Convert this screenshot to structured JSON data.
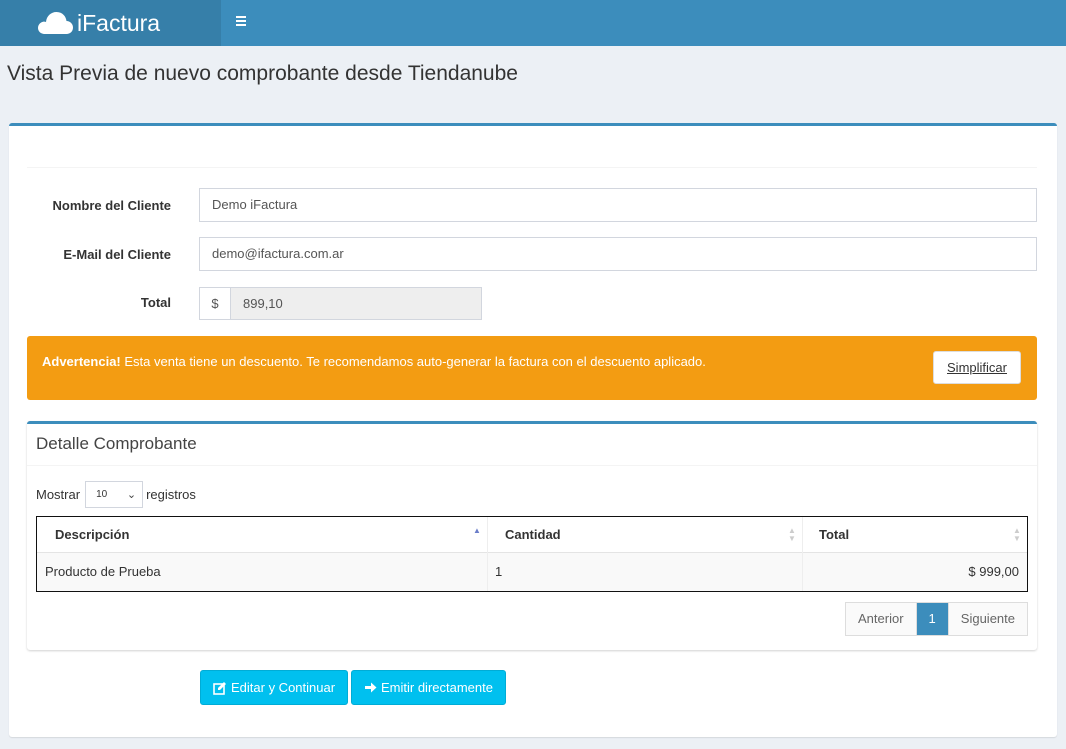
{
  "app": {
    "name": "iFactura"
  },
  "page": {
    "title": "Vista Previa de nuevo comprobante desde Tiendanube"
  },
  "form": {
    "client_name_label": "Nombre del Cliente",
    "client_name_value": "Demo iFactura",
    "client_email_label": "E-Mail del Cliente",
    "client_email_value": "demo@ifactura.com.ar",
    "total_label": "Total",
    "currency_symbol": "$",
    "total_value": "899,10"
  },
  "alert": {
    "strong": "Advertencia!",
    "text": " Esta venta tiene un descuento. Te recomendamos auto-generar la factura con el descuento aplicado.",
    "button": "Simplificar"
  },
  "detail": {
    "title": "Detalle Comprobante",
    "show_label": "Mostrar",
    "page_size": "10",
    "records_label": "registros",
    "columns": [
      "Descripción",
      "Cantidad",
      "Total"
    ],
    "rows": [
      {
        "description": "Producto de Prueba",
        "quantity": "1",
        "total": "$ 999,00"
      }
    ],
    "pagination": {
      "prev": "Anterior",
      "current": "1",
      "next": "Siguiente"
    }
  },
  "actions": {
    "edit_continue": "Editar y Continuar",
    "emit_direct": "Emitir directamente"
  },
  "colors": {
    "header": "#3c8dbc",
    "logo_bg": "#367fa9",
    "warning": "#f39c12",
    "info_button": "#00c0ef"
  }
}
